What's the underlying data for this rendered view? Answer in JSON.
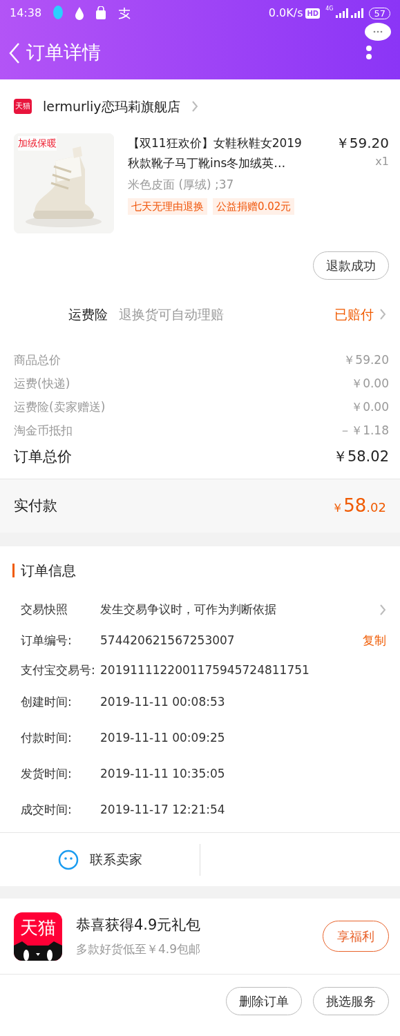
{
  "status_bar": {
    "time": "14:38",
    "net_speed": "0.0K/s",
    "hd": "HD",
    "network": "4G",
    "battery": "57"
  },
  "header": {
    "title": "订单详情"
  },
  "store": {
    "badge": "天猫",
    "name": "lermurliy恋玛莉旗舰店"
  },
  "product": {
    "kind": "picture",
    "image_tag": "加绒保暖",
    "title": "【双11狂欢价】女鞋秋鞋女2019秋款靴子马丁靴ins冬加绒英…",
    "price": "￥59.20",
    "quantity": "x1",
    "sku": "米色皮面 (厚绒) ;37",
    "tags": [
      "七天无理由退换",
      "公益捐赠0.02元"
    ],
    "refund_status": "退款成功"
  },
  "insurance": {
    "label": "运费险",
    "description": "退换货可自动理赔",
    "status": "已赔付"
  },
  "price_rows": [
    {
      "kind": "detail",
      "label": "商品总价",
      "value": "￥59.20"
    },
    {
      "kind": "detail",
      "label": "运费(快递)",
      "value": "￥0.00"
    },
    {
      "kind": "detail",
      "label": "运费险(卖家赠送)",
      "value": "￥0.00"
    },
    {
      "kind": "detail",
      "label": "淘金币抵扣",
      "value": "－￥1.18"
    },
    {
      "kind": "total",
      "label": "订单总价",
      "value": "￥58.02"
    }
  ],
  "paid": {
    "label": "实付款",
    "currency": "￥",
    "integer": "58",
    "decimal": ".02"
  },
  "order_info": {
    "title": "订单信息",
    "rows": [
      {
        "kind": "link",
        "label": "交易快照",
        "value": "发生交易争议时，可作为判断依据"
      },
      {
        "kind": "copy",
        "label": "订单编号:",
        "value": "574420621567253007",
        "action": "复制"
      },
      {
        "kind": "plain",
        "label": "支付宝交易号:",
        "value": "2019111122001175945724811751"
      },
      {
        "kind": "plain",
        "label": "创建时间:",
        "value": "2019-11-11 00:08:53"
      },
      {
        "kind": "plain",
        "label": "付款时间:",
        "value": "2019-11-11 00:09:25"
      },
      {
        "kind": "plain",
        "label": "发货时间:",
        "value": "2019-11-11 10:35:05"
      },
      {
        "kind": "plain",
        "label": "成交时间:",
        "value": "2019-11-17 12:21:54"
      }
    ]
  },
  "contact": {
    "label": "联系卖家"
  },
  "promo": {
    "logo": "天猫",
    "title": "恭喜获得4.9元礼包",
    "subtitle": "多款好货低至￥4.9包邮",
    "button": "享福利"
  },
  "actions": [
    "删除订单",
    "挑选服务"
  ]
}
